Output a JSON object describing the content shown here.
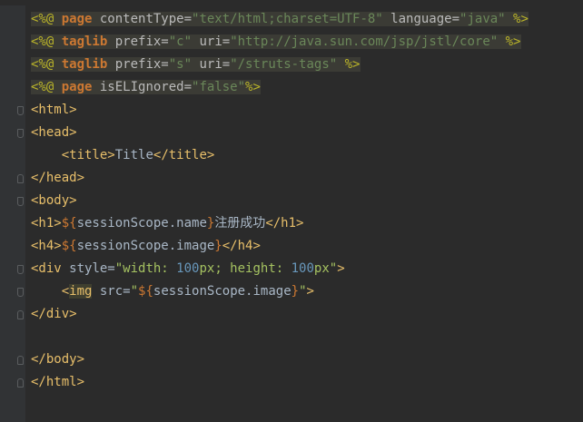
{
  "editor": {
    "language": "jsp",
    "lines": [
      {
        "id": 1,
        "segments": [
          [
            "dir",
            "<%@ "
          ],
          [
            "kw",
            "page"
          ],
          [
            "attr",
            " contentType="
          ],
          [
            "str",
            "\"text/html;charset=UTF-8\""
          ],
          [
            "attr",
            " language="
          ],
          [
            "str",
            "\"java\""
          ],
          [
            "dir",
            " %>"
          ]
        ]
      },
      {
        "id": 2,
        "segments": [
          [
            "dir",
            "<%@ "
          ],
          [
            "kw",
            "taglib"
          ],
          [
            "attr",
            " prefix="
          ],
          [
            "str",
            "\"c\""
          ],
          [
            "attr",
            " uri="
          ],
          [
            "str",
            "\"http://java.sun.com/jsp/jstl/core\""
          ],
          [
            "dir",
            " %>"
          ]
        ]
      },
      {
        "id": 3,
        "segments": [
          [
            "dir",
            "<%@ "
          ],
          [
            "kw",
            "taglib"
          ],
          [
            "attr",
            " prefix="
          ],
          [
            "str",
            "\"s\""
          ],
          [
            "attr",
            " uri="
          ],
          [
            "str",
            "\"/struts-tags\""
          ],
          [
            "dir",
            " %>"
          ]
        ]
      },
      {
        "id": 4,
        "segments": [
          [
            "dir",
            "<%@ "
          ],
          [
            "kw",
            "page"
          ],
          [
            "attr",
            " isELIgnored="
          ],
          [
            "str",
            "\"false\""
          ],
          [
            "dir",
            "%>"
          ]
        ]
      },
      {
        "id": 5,
        "segments": [
          [
            "tag",
            "<html>"
          ]
        ]
      },
      {
        "id": 6,
        "segments": [
          [
            "tag",
            "<head>"
          ]
        ]
      },
      {
        "id": 7,
        "segments": [
          [
            "txt",
            "    "
          ],
          [
            "tag",
            "<title>"
          ],
          [
            "txt",
            "Title"
          ],
          [
            "tag",
            "</title>"
          ]
        ]
      },
      {
        "id": 8,
        "segments": [
          [
            "tag",
            "</head>"
          ]
        ]
      },
      {
        "id": 9,
        "segments": [
          [
            "tag",
            "<body>"
          ]
        ]
      },
      {
        "id": 10,
        "segments": [
          [
            "tag",
            "<h1>"
          ],
          [
            "expr",
            "${"
          ],
          [
            "txt",
            "sessionScope.name"
          ],
          [
            "expr",
            "}"
          ],
          [
            "txt",
            "注册成功"
          ],
          [
            "tag",
            "</h1>"
          ]
        ]
      },
      {
        "id": 11,
        "segments": [
          [
            "tag",
            "<h4>"
          ],
          [
            "expr",
            "${"
          ],
          [
            "txt",
            "sessionScope.image"
          ],
          [
            "expr",
            "}"
          ],
          [
            "tag",
            "</h4>"
          ]
        ]
      },
      {
        "id": 12,
        "segments": [
          [
            "tag",
            "<div "
          ],
          [
            "attr2",
            "style="
          ],
          [
            "sval",
            "\"width: "
          ],
          [
            "num",
            "100"
          ],
          [
            "sval",
            "px; height: "
          ],
          [
            "num",
            "100"
          ],
          [
            "sval",
            "px\""
          ],
          [
            "tag",
            ">"
          ]
        ]
      },
      {
        "id": 13,
        "segments": [
          [
            "txt",
            "    "
          ],
          [
            "tag",
            "<"
          ],
          [
            "imgtag",
            "img"
          ],
          [
            "attr2",
            " src="
          ],
          [
            "sval",
            "\""
          ],
          [
            "expr",
            "${"
          ],
          [
            "txt",
            "sessionScope.image"
          ],
          [
            "expr",
            "}"
          ],
          [
            "sval",
            "\""
          ],
          [
            "tag",
            ">"
          ]
        ]
      },
      {
        "id": 14,
        "segments": [
          [
            "tag",
            "</div>"
          ]
        ]
      },
      {
        "id": 15,
        "segments": []
      },
      {
        "id": 16,
        "segments": [
          [
            "tag",
            "</body>"
          ]
        ]
      },
      {
        "id": 17,
        "segments": [
          [
            "tag",
            "</html>"
          ]
        ]
      },
      {
        "id": 18,
        "segments": []
      }
    ]
  },
  "gutter": {
    "fold_markers": [
      {
        "line": 5,
        "type": "down"
      },
      {
        "line": 6,
        "type": "down"
      },
      {
        "line": 8,
        "type": "up"
      },
      {
        "line": 9,
        "type": "down"
      },
      {
        "line": 12,
        "type": "down"
      },
      {
        "line": 13,
        "type": "down"
      },
      {
        "line": 14,
        "type": "up"
      },
      {
        "line": 16,
        "type": "up"
      },
      {
        "line": 17,
        "type": "up"
      }
    ],
    "fold_icon": "fold-marker-icon"
  },
  "colors": {
    "background": "#2b2b2b",
    "gutter": "#313335",
    "directive_bg": "#3b3b35",
    "tag": "#e8bf6a",
    "keyword": "#cc7832",
    "string": "#6a8759",
    "number": "#6897bb"
  }
}
